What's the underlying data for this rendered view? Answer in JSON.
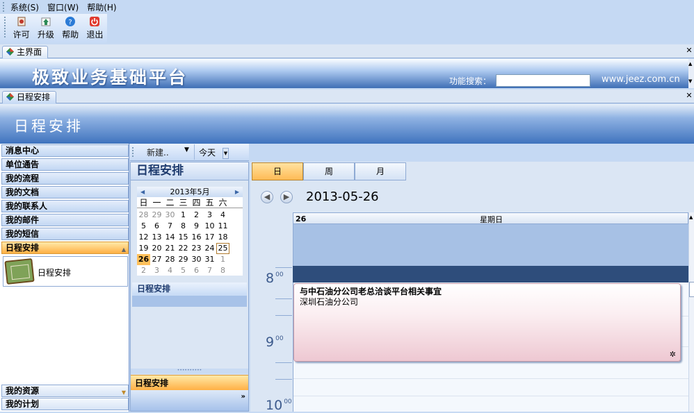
{
  "menu": [
    "系统(S)",
    "窗口(W)",
    "帮助(H)"
  ],
  "toolbar": [
    {
      "label": "许可",
      "icon": "license-icon",
      "color": "#c0392b"
    },
    {
      "label": "升级",
      "icon": "upgrade-icon",
      "color": "#2e8b57"
    },
    {
      "label": "帮助",
      "icon": "help-icon",
      "color": "#2b7bd6"
    },
    {
      "label": "退出",
      "icon": "power-icon",
      "color": "#e03a2e"
    }
  ],
  "main_tab": {
    "label": "主界面"
  },
  "banner": {
    "title": "极致业务基础平台",
    "search_label": "功能搜索：",
    "search_value": "",
    "site": "www.jeez.com.cn"
  },
  "module_tab": {
    "label": "日程安排"
  },
  "module_header": "日程安排",
  "nav": {
    "items": [
      "消息中心",
      "单位通告",
      "我的流程",
      "我的文档",
      "我的联系人",
      "我的邮件",
      "我的短信",
      "日程安排"
    ],
    "active": "日程安排",
    "active_content": "日程安排",
    "bottom_items": [
      "我的资源",
      "我的计划"
    ]
  },
  "mid_toolbar": {
    "new_label": "新建..",
    "today_label": "今天"
  },
  "mid_panel": {
    "title": "日程安排",
    "calendar": {
      "month_label": "2013年5月",
      "weekdays": [
        "日",
        "一",
        "二",
        "三",
        "四",
        "五",
        "六"
      ],
      "weeks": [
        [
          {
            "d": "28",
            "dim": true
          },
          {
            "d": "29",
            "dim": true
          },
          {
            "d": "30",
            "dim": true
          },
          {
            "d": "1"
          },
          {
            "d": "2"
          },
          {
            "d": "3"
          },
          {
            "d": "4"
          }
        ],
        [
          {
            "d": "5"
          },
          {
            "d": "6"
          },
          {
            "d": "7"
          },
          {
            "d": "8"
          },
          {
            "d": "9"
          },
          {
            "d": "10"
          },
          {
            "d": "11"
          }
        ],
        [
          {
            "d": "12"
          },
          {
            "d": "13"
          },
          {
            "d": "14"
          },
          {
            "d": "15"
          },
          {
            "d": "16"
          },
          {
            "d": "17"
          },
          {
            "d": "18"
          }
        ],
        [
          {
            "d": "19"
          },
          {
            "d": "20"
          },
          {
            "d": "21"
          },
          {
            "d": "22"
          },
          {
            "d": "23"
          },
          {
            "d": "24"
          },
          {
            "d": "25",
            "today": true
          }
        ],
        [
          {
            "d": "26",
            "selected": true
          },
          {
            "d": "27"
          },
          {
            "d": "28"
          },
          {
            "d": "29"
          },
          {
            "d": "30"
          },
          {
            "d": "31"
          },
          {
            "d": "1",
            "dim": true
          }
        ],
        [
          {
            "d": "2",
            "dim": true
          },
          {
            "d": "3",
            "dim": true
          },
          {
            "d": "4",
            "dim": true
          },
          {
            "d": "5",
            "dim": true
          },
          {
            "d": "6",
            "dim": true
          },
          {
            "d": "7",
            "dim": true
          },
          {
            "d": "8",
            "dim": true
          }
        ]
      ]
    },
    "section_label": "日程安排",
    "bottom_active": "日程安排"
  },
  "view": {
    "tabs": [
      "日",
      "周",
      "月"
    ],
    "active": "日",
    "date_label": "2013-05-26",
    "day_number": "26",
    "weekday": "星期日",
    "hours": [
      "8",
      "9",
      "10"
    ],
    "minutes": "00",
    "event": {
      "title": "与中石油分公司老总洽谈平台相关事宜",
      "location": "深圳石油分公司"
    }
  }
}
